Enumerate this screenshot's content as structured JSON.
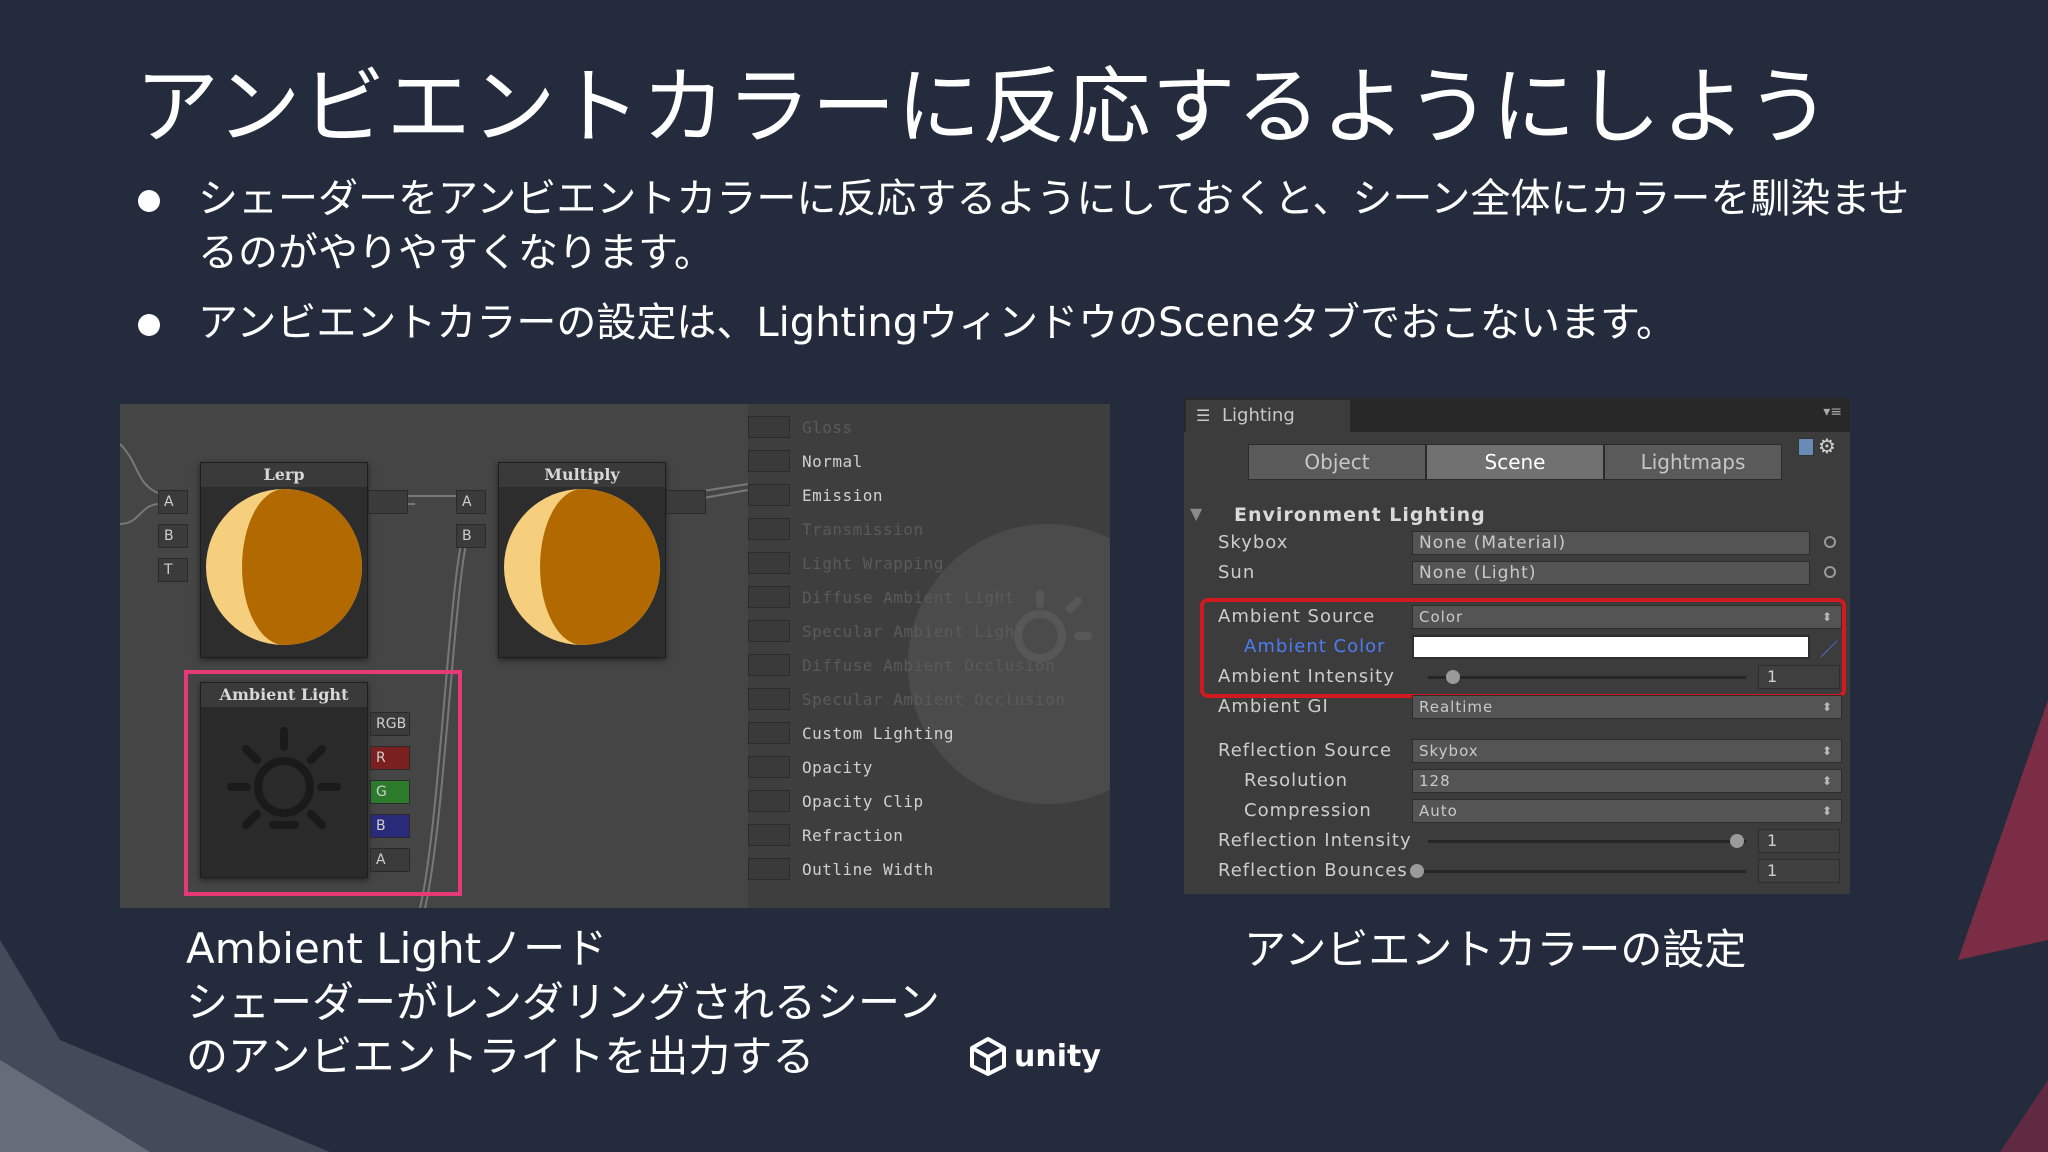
{
  "slide": {
    "title": "アンビエントカラーに反応するようにしよう",
    "bullets": [
      "シェーダーをアンビエントカラーに反応するようにしておくと、シーン全体にカラーを馴染ませるのがやりやすくなります。",
      "アンビエントカラーの設定は、LightingウィンドウのSceneタブでおこないます。"
    ],
    "caption_left": [
      "Ambient Lightノード",
      "シェーダーがレンダリングされるシーン",
      "のアンビエントライトを出力する"
    ],
    "caption_right": "アンビエントカラーの設定",
    "logo_text": "unity"
  },
  "editor": {
    "lerp_node": {
      "title": "Lerp",
      "inputs": [
        "A",
        "B",
        "T"
      ]
    },
    "multiply_node": {
      "title": "Multiply",
      "inputs": [
        "A",
        "B"
      ]
    },
    "ambient_node": {
      "title": "Ambient Light",
      "outputs": [
        "RGB",
        "R",
        "G",
        "B",
        "A"
      ]
    },
    "inputs": [
      {
        "label": "Gloss",
        "dim": true
      },
      {
        "label": "Normal",
        "dim": false
      },
      {
        "label": "Emission",
        "dim": false
      },
      {
        "label": "Transmission",
        "dim": true
      },
      {
        "label": "Light Wrapping",
        "dim": true
      },
      {
        "label": "Diffuse Ambient Light",
        "dim": true
      },
      {
        "label": "Specular Ambient Light",
        "dim": true
      },
      {
        "label": "Diffuse Ambient Occlusion",
        "dim": true
      },
      {
        "label": "Specular Ambient Occlusion",
        "dim": true
      },
      {
        "label": "Custom Lighting",
        "dim": false
      },
      {
        "label": "Opacity",
        "dim": false
      },
      {
        "label": "Opacity Clip",
        "dim": false
      },
      {
        "label": "Refraction",
        "dim": false
      },
      {
        "label": "Outline Width",
        "dim": false
      }
    ],
    "colors": {
      "sphere_orange": "#b26a00",
      "sphere_light": "#f5cf7e",
      "highlight": "#e53a76"
    }
  },
  "lighting": {
    "window_tab": "Lighting",
    "tabs": [
      "Object",
      "Scene",
      "Lightmaps"
    ],
    "active_tab": "Scene",
    "section": "Environment Lighting",
    "skybox": {
      "label": "Skybox",
      "value": "None (Material)"
    },
    "sun": {
      "label": "Sun",
      "value": "None (Light)"
    },
    "ambient_source": {
      "label": "Ambient Source",
      "value": "Color"
    },
    "ambient_color": {
      "label": "Ambient Color",
      "value": "#ffffff"
    },
    "ambient_intensity": {
      "label": "Ambient Intensity",
      "value": "1"
    },
    "ambient_gi": {
      "label": "Ambient GI",
      "value": "Realtime"
    },
    "reflection_source": {
      "label": "Reflection Source",
      "value": "Skybox"
    },
    "resolution": {
      "label": "Resolution",
      "value": "128"
    },
    "compression": {
      "label": "Compression",
      "value": "Auto"
    },
    "reflection_intensity": {
      "label": "Reflection Intensity",
      "value": "1"
    },
    "reflection_bounces": {
      "label": "Reflection Bounces",
      "value": "1"
    },
    "highlight_color": "#d01a20"
  }
}
